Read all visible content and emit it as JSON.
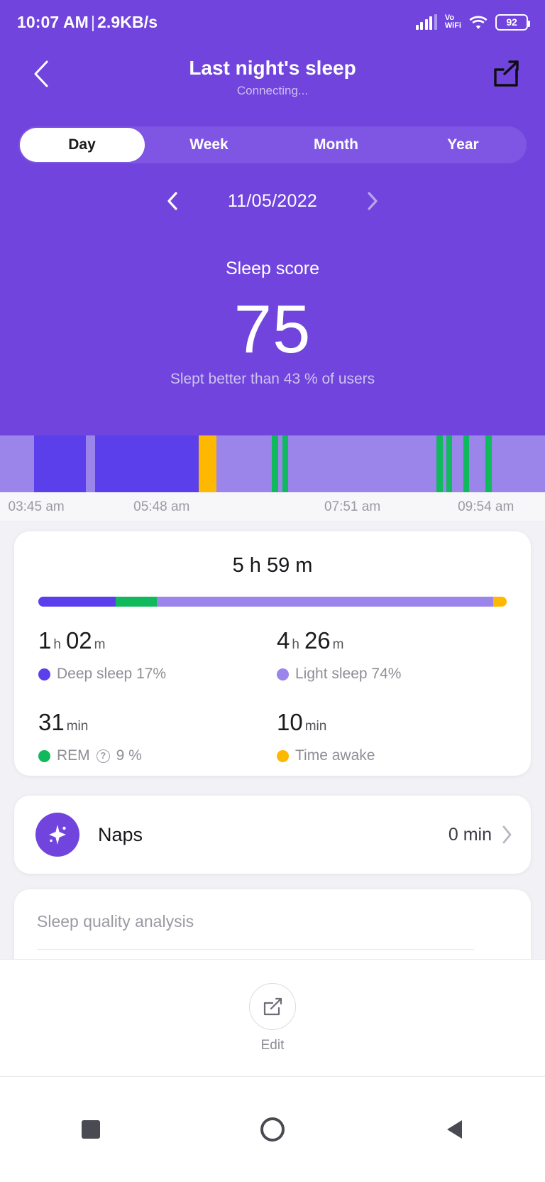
{
  "statusbar": {
    "time": "10:07 AM",
    "separator": "|",
    "network_speed": "2.9KB/s",
    "vowifi_line1": "Vo",
    "vowifi_line2": "WiFi",
    "battery_percent": "92"
  },
  "header": {
    "title": "Last night's sleep",
    "subtitle": "Connecting...",
    "back_icon": "chevron-left-icon",
    "share_icon": "share-external-icon"
  },
  "tabs": [
    {
      "label": "Day",
      "active": true
    },
    {
      "label": "Week",
      "active": false
    },
    {
      "label": "Month",
      "active": false
    },
    {
      "label": "Year",
      "active": false
    }
  ],
  "date_nav": {
    "prev_icon": "chevron-left-icon",
    "next_icon": "chevron-right-icon",
    "date": "11/05/2022"
  },
  "score": {
    "label": "Sleep score",
    "value": "75",
    "comparison": "Slept better than 43 % of users"
  },
  "colors": {
    "brand_purple": "#7044dd",
    "hero_purple": "#7044dd",
    "tabs_track": "#7e56e3",
    "deep_sleep": "#5b3fea",
    "light_sleep": "#9b84ea",
    "rem": "#10b95c",
    "awake": "#ffb800"
  },
  "chart_data": {
    "type": "bar",
    "title": "Sleep stages hypnogram",
    "xlabel": "",
    "ylabel": "",
    "grid": false,
    "legend_position": "below-cards",
    "axis_ticks": [
      "03:45 am",
      "05:48 am",
      "07:51 am",
      "09:54 am"
    ],
    "tick_positions_pct": [
      1.5,
      24.5,
      59.5,
      84
    ],
    "categories": [
      "deep",
      "light",
      "rem",
      "awake"
    ],
    "segments": [
      {
        "stage": "light",
        "color": "#9b84ea",
        "width_pct": 6.2
      },
      {
        "stage": "deep",
        "color": "#5b3fea",
        "width_pct": 9.5
      },
      {
        "stage": "light",
        "color": "#9b84ea",
        "width_pct": 1.7
      },
      {
        "stage": "deep",
        "color": "#5b3fea",
        "width_pct": 19.0
      },
      {
        "stage": "awake",
        "color": "#ffb800",
        "width_pct": 3.3
      },
      {
        "stage": "light",
        "color": "#9b84ea",
        "width_pct": 10.2
      },
      {
        "stage": "rem",
        "color": "#10b95c",
        "width_pct": 1.1
      },
      {
        "stage": "light",
        "color": "#9b84ea",
        "width_pct": 0.8
      },
      {
        "stage": "rem",
        "color": "#10b95c",
        "width_pct": 1.1
      },
      {
        "stage": "light",
        "color": "#9b84ea",
        "width_pct": 27.2
      },
      {
        "stage": "rem",
        "color": "#10b95c",
        "width_pct": 1.1
      },
      {
        "stage": "light",
        "color": "#9b84ea",
        "width_pct": 0.7
      },
      {
        "stage": "rem",
        "color": "#10b95c",
        "width_pct": 1.1
      },
      {
        "stage": "light",
        "color": "#9b84ea",
        "width_pct": 2.0
      },
      {
        "stage": "rem",
        "color": "#10b95c",
        "width_pct": 1.1
      },
      {
        "stage": "light",
        "color": "#9b84ea",
        "width_pct": 3.0
      },
      {
        "stage": "rem",
        "color": "#10b95c",
        "width_pct": 1.1
      },
      {
        "stage": "light",
        "color": "#9b84ea",
        "width_pct": 17.0
      },
      {
        "stage": "rem",
        "color": "#10b95c",
        "width_pct": 1.1
      },
      {
        "stage": "light",
        "color": "#9b84ea",
        "width_pct": 5.5
      }
    ],
    "stacked_bar": {
      "values_pct": [
        17,
        9,
        74,
        3
      ],
      "series": [
        {
          "name": "Deep sleep",
          "pct": 17,
          "color": "#5b3fea"
        },
        {
          "name": "REM",
          "pct": 9,
          "color": "#10b95c"
        },
        {
          "name": "Light sleep",
          "pct": 74,
          "color": "#9b84ea"
        },
        {
          "name": "Time awake",
          "pct": 3,
          "color": "#ffb800"
        }
      ]
    }
  },
  "summary": {
    "total_duration": "5 h 59 m",
    "stats": [
      {
        "value_num": "1",
        "unit1": "h",
        "value_num2": "02",
        "unit2": "m",
        "label": "Deep sleep 17%",
        "dot_color": "#5b3fea",
        "has_info": false
      },
      {
        "value_num": "4",
        "unit1": "h",
        "value_num2": "26",
        "unit2": "m",
        "label": "Light sleep 74%",
        "dot_color": "#9b84ea",
        "has_info": false
      },
      {
        "value_num": "31",
        "unit1": "min",
        "value_num2": "",
        "unit2": "",
        "label_before": "REM",
        "label_after": "9 %",
        "label": "REM 9 %",
        "dot_color": "#10b95c",
        "has_info": true,
        "info_glyph": "?"
      },
      {
        "value_num": "10",
        "unit1": "min",
        "value_num2": "",
        "unit2": "",
        "label": "Time awake",
        "dot_color": "#ffb800",
        "has_info": false
      }
    ]
  },
  "naps": {
    "icon": "sparkle-icon",
    "title": "Naps",
    "value": "0 min",
    "chevron": "chevron-right-icon"
  },
  "analysis": {
    "title": "Sleep quality analysis"
  },
  "bottom_bar": {
    "edit_icon": "edit-pencil-icon",
    "edit_label": "Edit"
  },
  "android_nav": {
    "recent_icon": "square-icon",
    "home_icon": "circle-icon",
    "back_icon": "triangle-back-icon"
  }
}
